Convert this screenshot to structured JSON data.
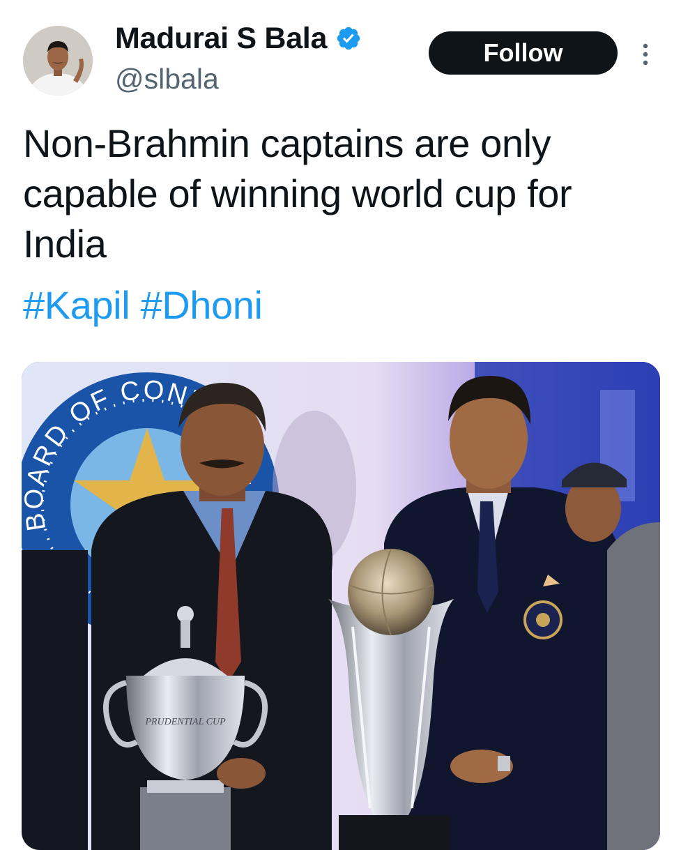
{
  "tweet": {
    "author": {
      "display_name": "Madurai S Bala",
      "handle": "@slbala",
      "verified": true
    },
    "follow_label": "Follow",
    "text": "Non-Brahmin captains are only capable of winning world cup for India",
    "hashtags": [
      "#Kapil",
      "#Dhoni"
    ]
  },
  "media": {
    "logo_text": "BOARD OF CONTROL FOR",
    "trophy_inscription": "PRUDENTIAL CUP"
  },
  "colors": {
    "link": "#1d9bf0",
    "verified": "#1d9bf0",
    "follow_bg": "#0f1419",
    "secondary_text": "#536471"
  },
  "icons": {
    "verified": "verified-badge-icon",
    "more": "more-vertical-icon"
  }
}
